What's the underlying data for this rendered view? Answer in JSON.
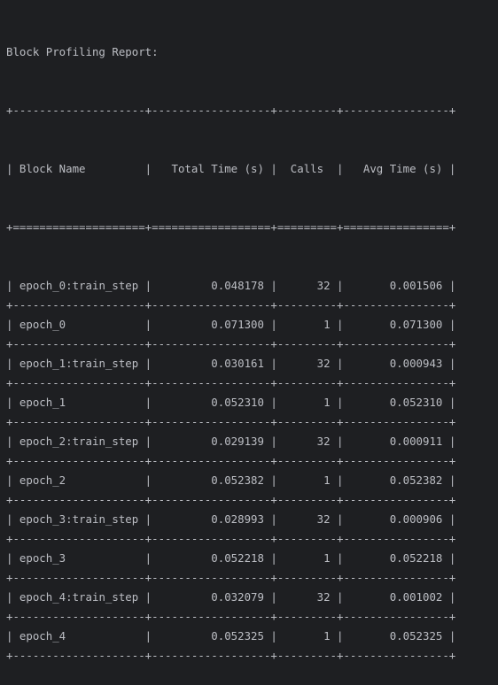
{
  "terminal": {
    "title": "Block Profiling Report:",
    "border": "+--------------------+------------------+---------+----------------+",
    "header_sep": "+====================+==================+=========+================+",
    "headers": [
      "Block Name",
      "Total Time (s)",
      "Calls",
      "Avg Time (s)"
    ],
    "rows": [
      {
        "name": "epoch_0:train_step",
        "total": "0.048178",
        "calls": "32",
        "avg": "0.001506"
      },
      {
        "name": "epoch_0",
        "total": "0.071300",
        "calls": "1",
        "avg": "0.071300"
      },
      {
        "name": "epoch_1:train_step",
        "total": "0.030161",
        "calls": "32",
        "avg": "0.000943"
      },
      {
        "name": "epoch_1",
        "total": "0.052310",
        "calls": "1",
        "avg": "0.052310"
      },
      {
        "name": "epoch_2:train_step",
        "total": "0.029139",
        "calls": "32",
        "avg": "0.000911"
      },
      {
        "name": "epoch_2",
        "total": "0.052382",
        "calls": "1",
        "avg": "0.052382"
      },
      {
        "name": "epoch_3:train_step",
        "total": "0.028993",
        "calls": "32",
        "avg": "0.000906"
      },
      {
        "name": "epoch_3",
        "total": "0.052218",
        "calls": "1",
        "avg": "0.052218"
      },
      {
        "name": "epoch_4:train_step",
        "total": "0.032079",
        "calls": "32",
        "avg": "0.001002"
      },
      {
        "name": "epoch_4",
        "total": "0.052325",
        "calls": "1",
        "avg": "0.052325"
      }
    ]
  }
}
